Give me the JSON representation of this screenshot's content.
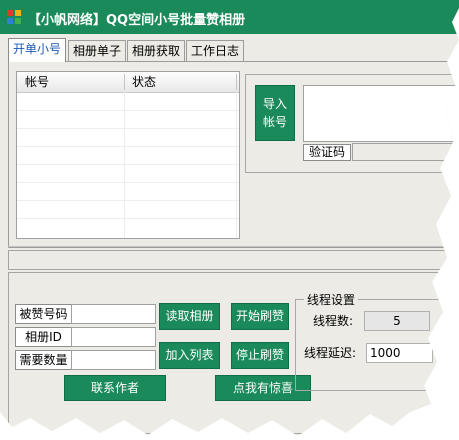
{
  "window": {
    "title": "【小帆网络】QQ空间小号批量赞相册"
  },
  "tabs": [
    {
      "label": "开单小号",
      "active": true
    },
    {
      "label": "相册单子"
    },
    {
      "label": "相册获取"
    },
    {
      "label": "工作日志"
    }
  ],
  "account_list": {
    "columns": [
      "帐号",
      "状态"
    ],
    "rows": []
  },
  "import": {
    "button_label": "导入\n帐号",
    "textarea_value": ""
  },
  "captcha": {
    "label": "验证码",
    "value": ""
  },
  "form": {
    "liked_qq_label": "被赞号码",
    "liked_qq_value": "",
    "album_id_label": "相册ID",
    "album_id_value": "",
    "quantity_label": "需要数量",
    "quantity_value": ""
  },
  "actions": {
    "read_album": "读取相册",
    "start_like": "开始刷赞",
    "add_list": "加入列表",
    "stop_like": "停止刷赞",
    "contact_author": "联系作者",
    "surprise": "点我有惊喜"
  },
  "thread_settings": {
    "legend": "线程设置",
    "threads_label": "线程数:",
    "threads_value": "5",
    "delay_label": "线程延迟:",
    "delay_value": "1000"
  },
  "colors": {
    "accent": "#1a8a5a",
    "tab_active_text": "#1e5ab4",
    "window_bg": "#ecebe6"
  },
  "icons": {
    "app": "colorful-pinwheel-icon"
  }
}
